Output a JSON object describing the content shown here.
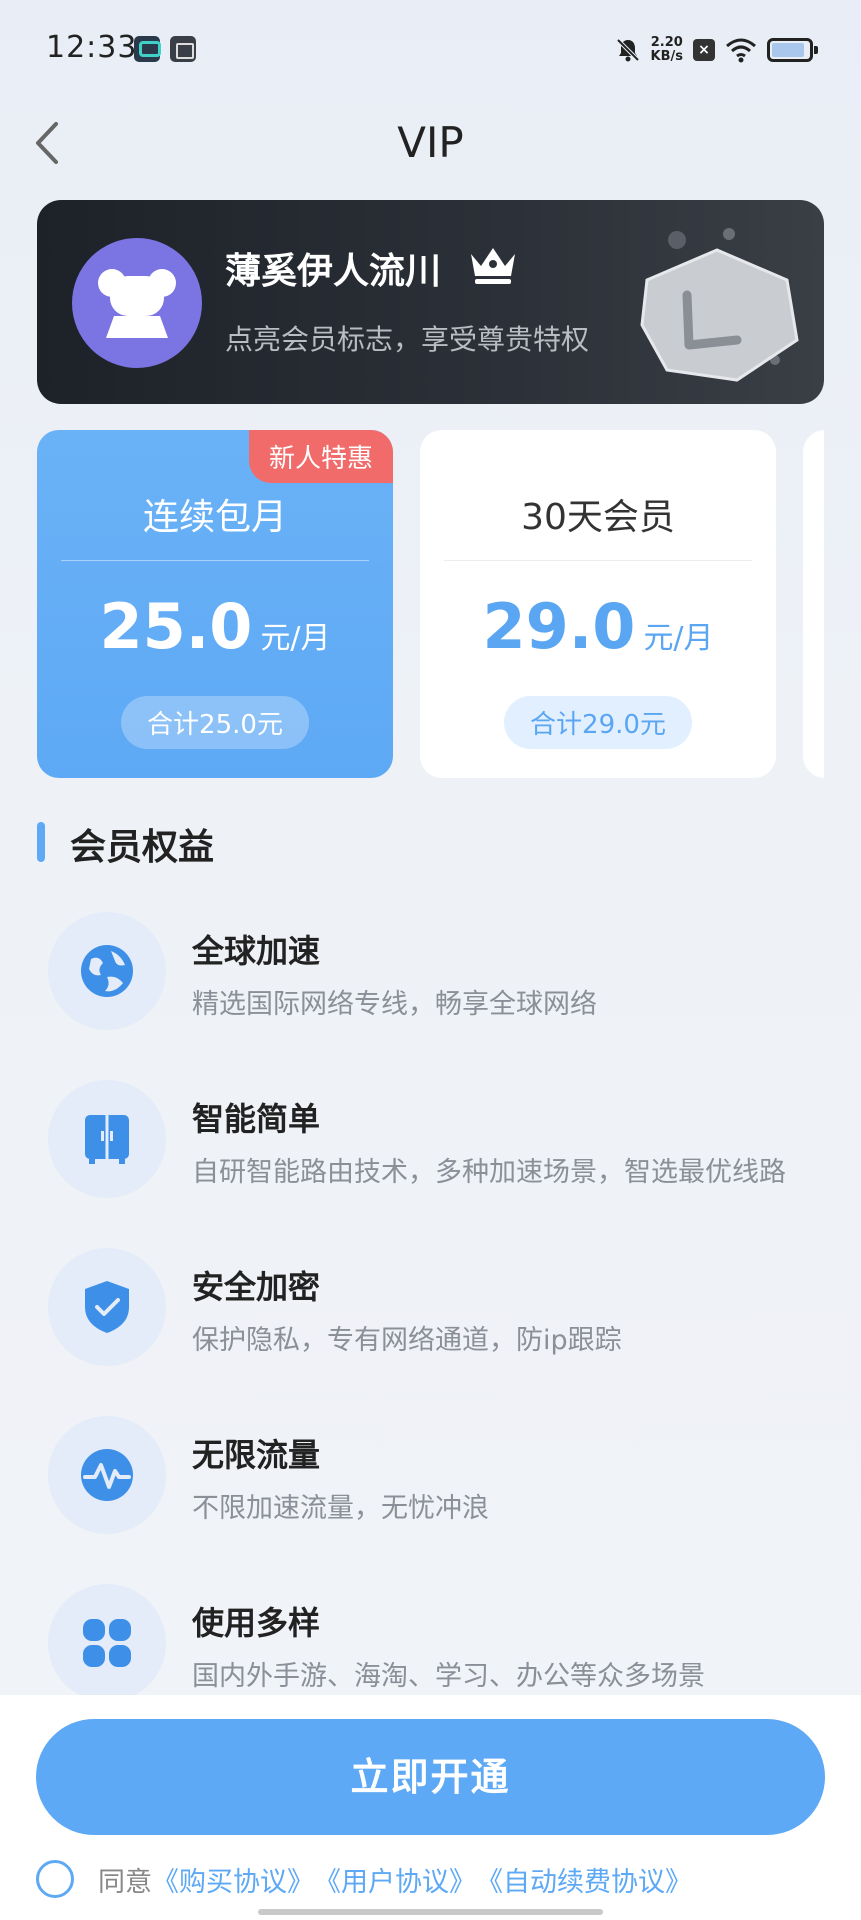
{
  "status_bar": {
    "time": "12:33",
    "net_speed": "2.20",
    "net_unit": "KB/s",
    "x_badge": "×"
  },
  "header": {
    "title": "VIP"
  },
  "user": {
    "name": "薄奚伊人流川",
    "subtitle": "点亮会员标志，享受尊贵特权"
  },
  "plans": [
    {
      "name": "连续包月",
      "price": "25.0",
      "unit": "元/月",
      "total": "合计25.0元",
      "tag": "新人特惠",
      "selected": true
    },
    {
      "name": "30天会员",
      "price": "29.0",
      "unit": "元/月",
      "total": "合计29.0元",
      "selected": false
    }
  ],
  "benefits_section": {
    "title": "会员权益"
  },
  "benefits": [
    {
      "icon": "globe-icon",
      "title": "全球加速",
      "desc": "精选国际网络专线，畅享全球网络"
    },
    {
      "icon": "cabinet-icon",
      "title": "智能简单",
      "desc": "自研智能路由技术，多种加速场景，智选最优线路"
    },
    {
      "icon": "shield-icon",
      "title": "安全加密",
      "desc": "保护隐私，专有网络通道，防ip跟踪"
    },
    {
      "icon": "pulse-icon",
      "title": "无限流量",
      "desc": "不限加速流量，无忧冲浪"
    },
    {
      "icon": "grid-icon",
      "title": "使用多样",
      "desc": "国内外手游、海淘、学习、办公等众多场景"
    }
  ],
  "footer": {
    "open_label": "立即开通",
    "agree_prefix": "同意",
    "links": [
      "《购买协议》",
      "《用户协议》",
      "《自动续费协议》"
    ]
  },
  "colors": {
    "accent": "#5ea9f5",
    "tag": "#f26b6b",
    "avatar": "#7b74e3"
  }
}
